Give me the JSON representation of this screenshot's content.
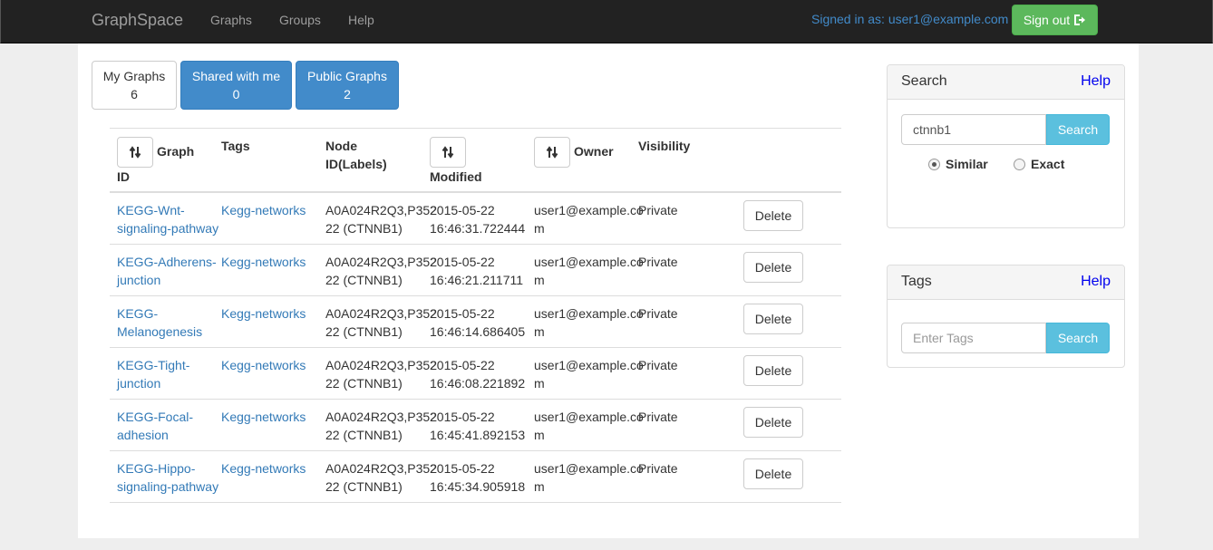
{
  "navbar": {
    "brand": "GraphSpace",
    "links": [
      "Graphs",
      "Groups",
      "Help"
    ],
    "signed_in": "Signed in as: user1@example.com",
    "signout": "Sign out"
  },
  "tabs": [
    {
      "label": "My Graphs",
      "count": "6"
    },
    {
      "label": "Shared with me",
      "count": "0"
    },
    {
      "label": "Public Graphs",
      "count": "2"
    }
  ],
  "table": {
    "headers": {
      "graph_a": "Graph",
      "graph_b": "ID",
      "tags": "Tags",
      "node_a": "Node",
      "node_b": "ID(Labels)",
      "modified": "Modified",
      "owner": "Owner",
      "visibility": "Visibility"
    },
    "rows": [
      {
        "id1": "KEGG-Wnt-",
        "id2": "signaling-pathway",
        "tags": "Kegg-networks",
        "node1": "A0A024R2Q3,P352",
        "node2": "22 (CTNNB1)",
        "mod1": "2015-05-22",
        "mod2": "16:46:31.722444",
        "own1": "user1@example.co",
        "own2": "m",
        "vis": "Private",
        "del": "Delete"
      },
      {
        "id1": "KEGG-Adherens-",
        "id2": "junction",
        "tags": "Kegg-networks",
        "node1": "A0A024R2Q3,P352",
        "node2": "22 (CTNNB1)",
        "mod1": "2015-05-22",
        "mod2": "16:46:21.211711",
        "own1": "user1@example.co",
        "own2": "m",
        "vis": "Private",
        "del": "Delete"
      },
      {
        "id1": "KEGG-",
        "id2": "Melanogenesis",
        "tags": "Kegg-networks",
        "node1": "A0A024R2Q3,P352",
        "node2": "22 (CTNNB1)",
        "mod1": "2015-05-22",
        "mod2": "16:46:14.686405",
        "own1": "user1@example.co",
        "own2": "m",
        "vis": "Private",
        "del": "Delete"
      },
      {
        "id1": "KEGG-Tight-",
        "id2": "junction",
        "tags": "Kegg-networks",
        "node1": "A0A024R2Q3,P352",
        "node2": "22 (CTNNB1)",
        "mod1": "2015-05-22",
        "mod2": "16:46:08.221892",
        "own1": "user1@example.co",
        "own2": "m",
        "vis": "Private",
        "del": "Delete"
      },
      {
        "id1": "KEGG-Focal-",
        "id2": "adhesion",
        "tags": "Kegg-networks",
        "node1": "A0A024R2Q3,P352",
        "node2": "22 (CTNNB1)",
        "mod1": "2015-05-22",
        "mod2": "16:45:41.892153",
        "own1": "user1@example.co",
        "own2": "m",
        "vis": "Private",
        "del": "Delete"
      },
      {
        "id1": "KEGG-Hippo-",
        "id2": "signaling-pathway",
        "tags": "Kegg-networks",
        "node1": "A0A024R2Q3,P352",
        "node2": "22 (CTNNB1)",
        "mod1": "2015-05-22",
        "mod2": "16:45:34.905918",
        "own1": "user1@example.co",
        "own2": "m",
        "vis": "Private",
        "del": "Delete"
      }
    ]
  },
  "search_panel": {
    "title": "Search",
    "help": "Help",
    "value": "ctnnb1",
    "button": "Search",
    "options": [
      "Similar",
      "Exact"
    ],
    "selected": "Similar"
  },
  "tags_panel": {
    "title": "Tags",
    "help": "Help",
    "placeholder": "Enter Tags",
    "button": "Search"
  },
  "colors": {
    "navbar": "#222222",
    "primary": "#428bca",
    "success": "#5cb85c",
    "info": "#5bc0de",
    "link": "#337ab7"
  }
}
